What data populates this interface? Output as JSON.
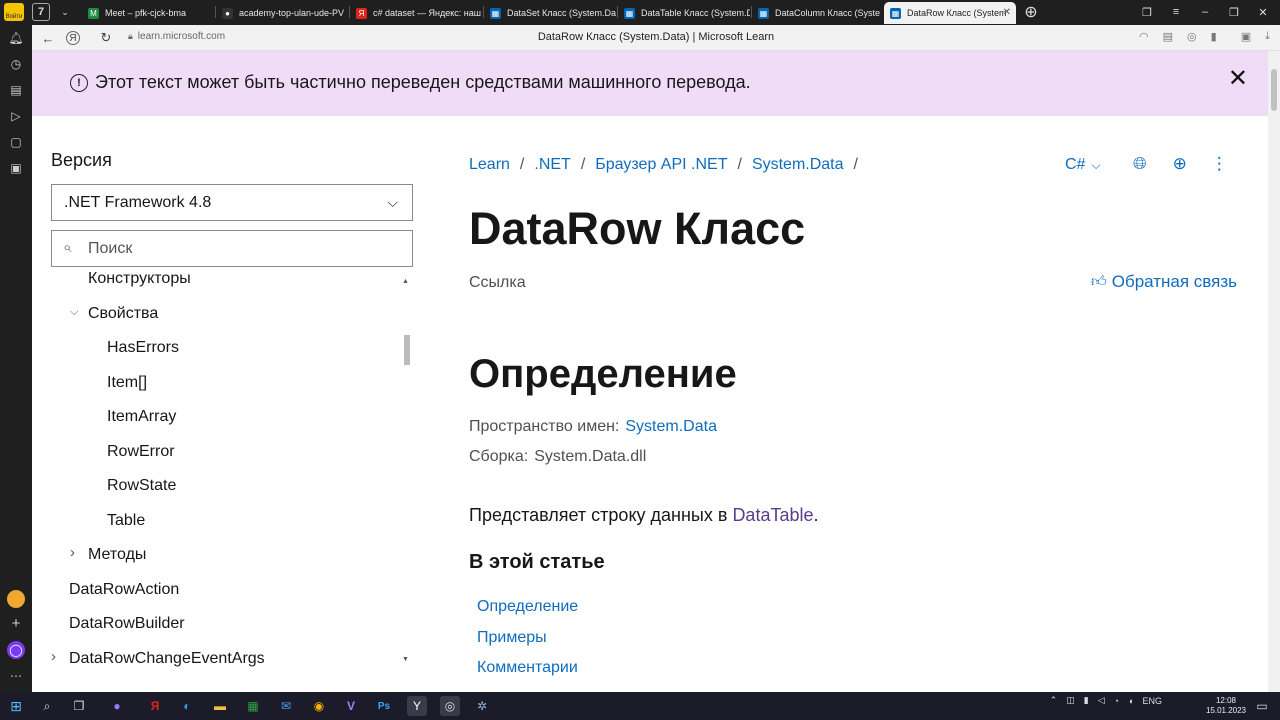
{
  "browser": {
    "tabs": [
      {
        "label": "Meet – pfk-cjck-bma",
        "color": "#1e8e3e",
        "glyph": "M"
      },
      {
        "label": "academy-top-ulan-ude-PV",
        "color": "#333333",
        "glyph": "●"
      },
      {
        "label": "c# dataset — Яндекс: наш",
        "color": "#e2231a",
        "glyph": "Я"
      },
      {
        "label": "DataSet Класс (System.Dat",
        "color": "#0067b8",
        "glyph": "▦"
      },
      {
        "label": "DataTable Класс (System.D",
        "color": "#0067b8",
        "glyph": "▦"
      },
      {
        "label": "DataColumn Класс (Syster",
        "color": "#0067b8",
        "glyph": "▦"
      },
      {
        "label": "DataRow Класс (System",
        "color": "#0067b8",
        "glyph": "▦",
        "active": true
      }
    ],
    "tab_count_badge": "7",
    "url": "learn.microsoft.com",
    "page_title": "DataRow Класс (System.Data) | Microsoft Learn",
    "login_label": "Войти"
  },
  "banner": {
    "text": "Этот текст может быть частично переведен средствами машинного перевода.",
    "info_glyph": "!",
    "close_glyph": "✕"
  },
  "toc": {
    "version_label": "Версия",
    "version_value": ".NET Framework 4.8",
    "search_placeholder": "Поиск",
    "items": [
      {
        "label": "Конструкторы",
        "level": 2
      },
      {
        "label": "Свойства",
        "level": 2,
        "expanded": true
      },
      {
        "label": "HasErrors",
        "level": 3
      },
      {
        "label": "Item[]",
        "level": 3
      },
      {
        "label": "ItemArray",
        "level": 3
      },
      {
        "label": "RowError",
        "level": 3
      },
      {
        "label": "RowState",
        "level": 3
      },
      {
        "label": "Table",
        "level": 3
      },
      {
        "label": "Методы",
        "level": 2,
        "expanded": false
      },
      {
        "label": "DataRowAction",
        "level": 1
      },
      {
        "label": "DataRowBuilder",
        "level": 1
      },
      {
        "label": "DataRowChangeEventArgs",
        "level": 1,
        "expanded": false
      }
    ]
  },
  "main": {
    "breadcrumbs": [
      "Learn",
      ".NET",
      "Браузер API .NET",
      "System.Data"
    ],
    "lang": "C#",
    "title": "DataRow Класс",
    "reference_label": "Ссылка",
    "feedback_label": "Обратная связь",
    "definition_heading": "Определение",
    "namespace_label": "Пространство имен:",
    "namespace_value": "System.Data",
    "assembly_label": "Сборка:",
    "assembly_value": "System.Data.dll",
    "description_prefix": "Представляет строку данных в",
    "description_link": "DataTable",
    "description_suffix": ".",
    "in_article_heading": "В этой статье",
    "in_article_links": [
      "Определение",
      "Примеры",
      "Комментарии"
    ]
  },
  "taskbar": {
    "lang": "ENG",
    "time": "12:08",
    "date": "15.01.2023"
  },
  "colors": {
    "banner_bg": "#f1dcf8",
    "link": "#0f6cbd",
    "visited_link": "#5a3d8a"
  }
}
